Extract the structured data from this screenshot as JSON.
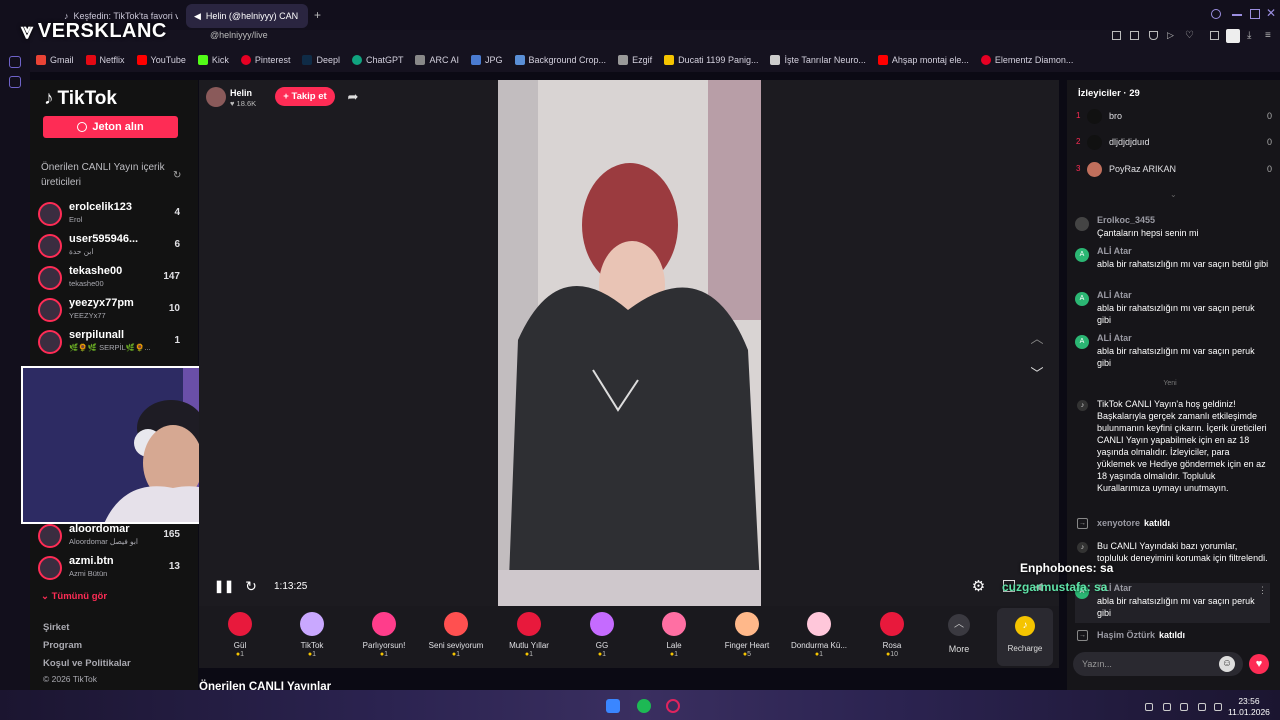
{
  "watermark": "VERSKLANC",
  "browser": {
    "tabs": [
      {
        "label": "Keşfedin: TikTok'ta favori v"
      },
      {
        "label": "Helin (@helniyyy) CAN"
      }
    ],
    "url": "@helniyyy/live",
    "bookmarks": [
      {
        "label": "Gmail",
        "color": "#ea4335"
      },
      {
        "label": "Netflix",
        "color": "#e50914"
      },
      {
        "label": "YouTube",
        "color": "#ff0000"
      },
      {
        "label": "Kick",
        "color": "#53fc18"
      },
      {
        "label": "Pinterest",
        "color": "#e60023"
      },
      {
        "label": "Deepl",
        "color": "#0f2b46"
      },
      {
        "label": "ChatGPT",
        "color": "#10a37f"
      },
      {
        "label": "ARC AI",
        "color": "#888888"
      },
      {
        "label": "JPG",
        "color": "#4a7bd0"
      },
      {
        "label": "Background Crop...",
        "color": "#5a8fd6"
      },
      {
        "label": "Ezgif",
        "color": "#999999"
      },
      {
        "label": "Ducati 1199 Panig...",
        "color": "#f5c400"
      },
      {
        "label": "İşte Tanrılar Neuro...",
        "color": "#cccccc"
      },
      {
        "label": "Ahşap montaj ele...",
        "color": "#ff0000"
      },
      {
        "label": "Elementz Diamon...",
        "color": "#e60023"
      }
    ]
  },
  "sidebar": {
    "logo": "TikTok",
    "coins_button": "Jeton alın",
    "suggested_title": "Önerilen CANLI Yayın içerik üreticileri",
    "creators": [
      {
        "name": "erolcelik123",
        "sub": "Erol",
        "count": "4"
      },
      {
        "name": "user595946...",
        "sub": "ابن حدة",
        "count": "6"
      },
      {
        "name": "tekashe00",
        "sub": "tekashe00",
        "count": "147"
      },
      {
        "name": "yeezyx77pm",
        "sub": "YEEZYx77",
        "count": "10"
      },
      {
        "name": "serpilunall",
        "sub": "🌿🌻🌿 SERPİL🌿🌻...",
        "count": "1"
      },
      {
        "name": "aloordomar",
        "sub": "Aloordomar ابو فيصل",
        "count": "165"
      },
      {
        "name": "azmi.btn",
        "sub": "Azmi Bütün",
        "count": "13"
      }
    ],
    "see_all": "Tümünü gör",
    "footer": [
      "Şirket",
      "Program",
      "Koşul ve Politikalar",
      "© 2026 TikTok"
    ]
  },
  "stream": {
    "host_name": "Helin",
    "host_likes": "18.6K",
    "follow_label": "+ Takip et",
    "elapsed": "1:13:25",
    "suggested_lives_title": "Önerilen CANLI Yayınlar"
  },
  "gifts": [
    {
      "name": "Gül",
      "price": "1",
      "color": "#e8193c"
    },
    {
      "name": "TikTok",
      "price": "1",
      "color": "#c9a8ff"
    },
    {
      "name": "Parlıyorsun!",
      "price": "1",
      "color": "#ff3d8b"
    },
    {
      "name": "Seni seviyorum",
      "price": "1",
      "color": "#ff5050"
    },
    {
      "name": "Mutlu Yıllar",
      "price": "1",
      "color": "#e8193c"
    },
    {
      "name": "GG",
      "price": "1",
      "color": "#c56bff"
    },
    {
      "name": "Lale",
      "price": "1",
      "color": "#ff6fa3"
    },
    {
      "name": "Finger Heart",
      "price": "5",
      "color": "#ffb88a"
    },
    {
      "name": "Dondurma Kü...",
      "price": "1",
      "color": "#ffc7da"
    },
    {
      "name": "Rosa",
      "price": "10",
      "color": "#e8193c"
    }
  ],
  "gift_more": "More",
  "recharge": "Recharge",
  "chat": {
    "viewers_title": "İzleyiciler · 29",
    "top_viewers": [
      {
        "rank": "1",
        "name": "bro",
        "score": "0"
      },
      {
        "rank": "2",
        "name": "dljdjdjduıd",
        "score": "0"
      },
      {
        "rank": "3",
        "name": "PoyRaz ARIKAN",
        "score": "0"
      }
    ],
    "messages": [
      {
        "user": "Erolkoc_3455",
        "text": "Çantaların hepsi senin mi"
      },
      {
        "user": "ALİ Atar",
        "text": "abla bir rahatsızlığın mı var saçın betül gibi"
      },
      {
        "user": "ALİ Atar",
        "text": "abla bir rahatsızlığın mı var saçın peruk gibi"
      },
      {
        "user": "ALİ Atar",
        "text": "abla bir rahatsızlığın mı var saçın peruk gibi"
      }
    ],
    "new_divider": "Yeni",
    "welcome": "TikTok CANLI Yayın'a hoş geldiniz! Başkalarıyla gerçek zamanlı etkileşimde bulunmanın keyfini çıkarın. İçerik üreticileri CANLI Yayın yapabilmek için en az 18 yaşında olmalıdır. İzleyiciler, para yüklemek ve Hediye göndermek için en az 18 yaşında olmalıdır. Topluluk Kurallarımıza uymayı unutmayın.",
    "join_1": {
      "user": "xenyotore",
      "action": "katıldı"
    },
    "filter_notice": "Bu CANLI Yayındaki bazı yorumlar, topluluk deneyimini korumak için filtrelendi.",
    "last_message": {
      "user": "ALİ Atar",
      "text": "abla bir rahatsızlığın mı var saçın peruk gibi"
    },
    "join_2": {
      "user": "Haşim Öztürk",
      "action": "katıldı"
    },
    "input_placeholder": "Yazın..."
  },
  "overlay_chat": [
    "Enphobones: sa",
    "cuzgarmustafa: sa"
  ],
  "clock": {
    "time": "23:56",
    "date": "11.01.2026"
  }
}
